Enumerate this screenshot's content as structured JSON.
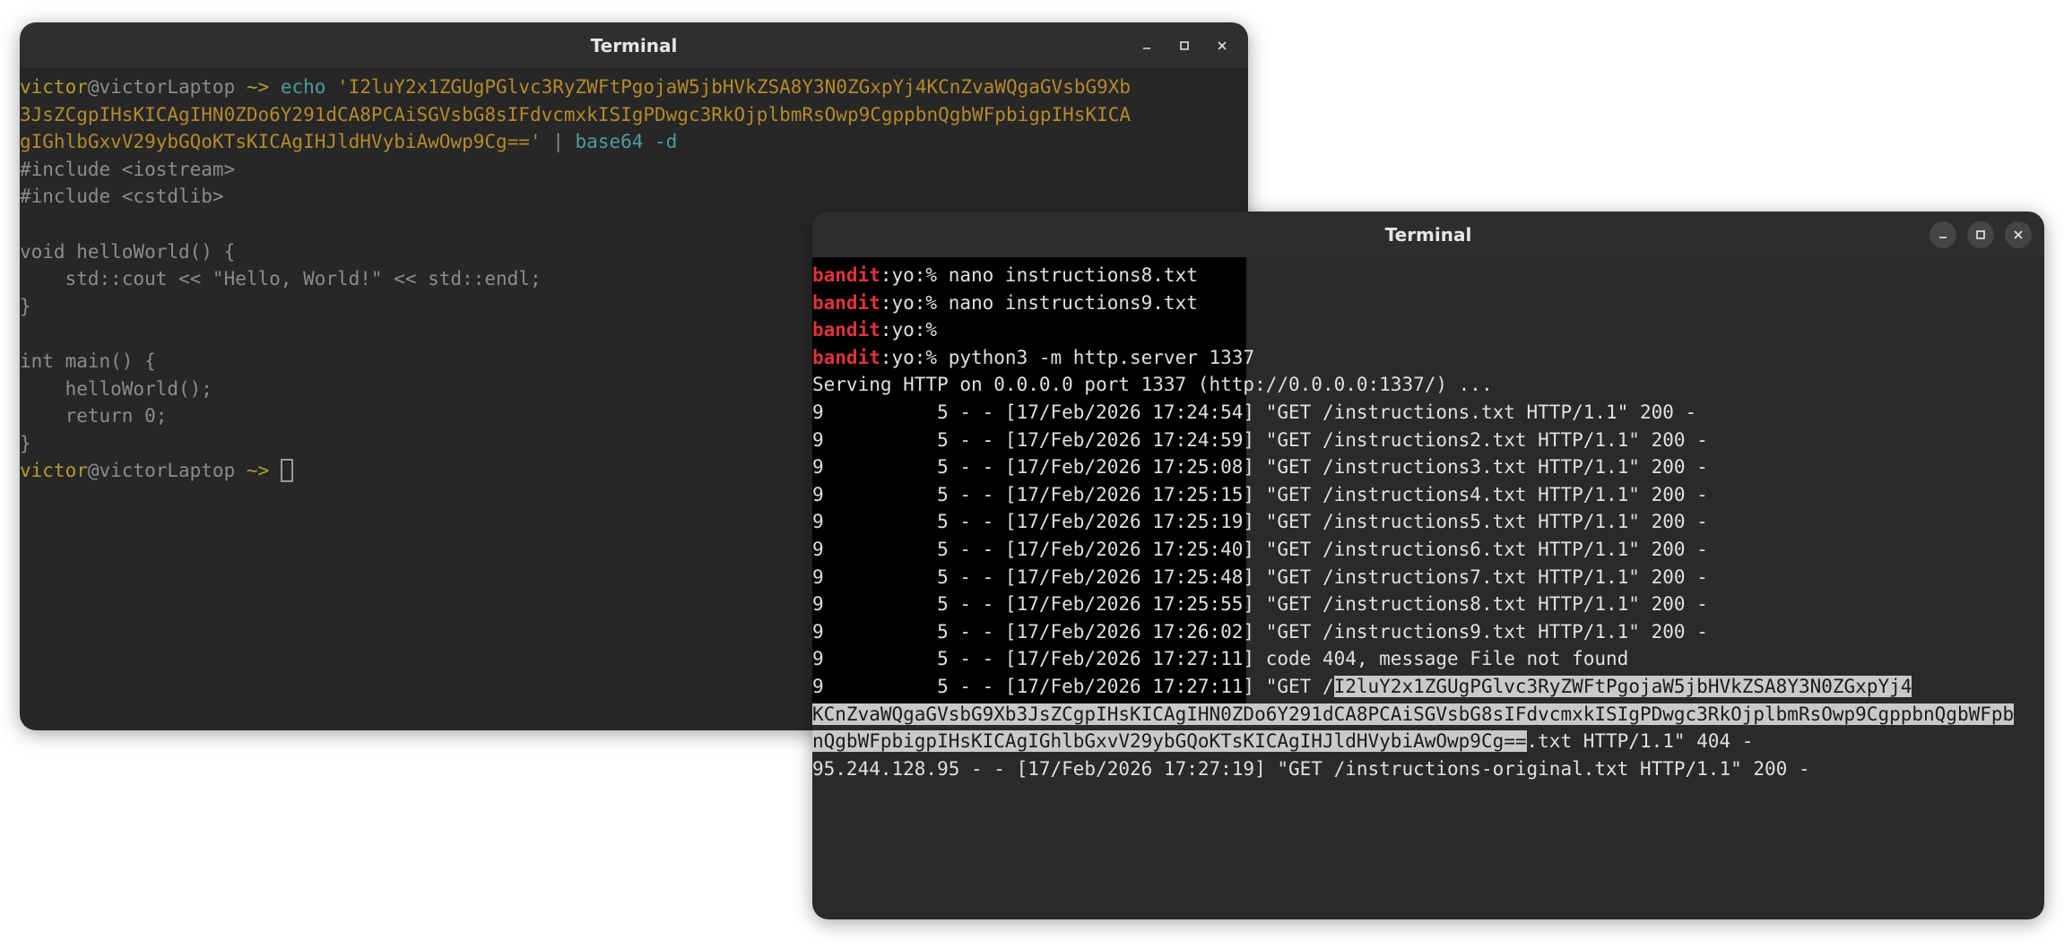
{
  "windows": [
    {
      "title": "Terminal",
      "lines": [
        {
          "segments": [
            {
              "text": "victor",
              "cls": "c-user"
            },
            {
              "text": "@victorLaptop ",
              "cls": "c-host"
            },
            {
              "text": "~> ",
              "cls": "c-arrow"
            },
            {
              "text": "echo ",
              "cls": "c-cmd"
            },
            {
              "text": "'I2luY2x1ZGUgPGlvc3RyZWFtPgojaW5jbHVkZSA8Y3N0ZGxpYj4KCnZvaWQgaGVsbG9Xb",
              "cls": "c-str"
            }
          ]
        },
        {
          "segments": [
            {
              "text": "3JsZCgpIHsKICAgIHN0ZDo6Y291dCA8PCAiSGVsbG8sIFdvcmxkISIgPDwgc3RkOjplbmRsOwp9CgppbnQgbWFpbigpIHsKICA",
              "cls": "c-str"
            }
          ]
        },
        {
          "segments": [
            {
              "text": "gIGhlbGxvV29ybGQoKTsKICAgIHJldHVybiAwOwp9Cg=='",
              "cls": "c-str"
            },
            {
              "text": " | ",
              "cls": "c-pipe"
            },
            {
              "text": "base64 -d",
              "cls": "c-cmd"
            }
          ]
        },
        {
          "segments": [
            {
              "text": "#include <iostream>",
              "cls": ""
            }
          ]
        },
        {
          "segments": [
            {
              "text": "#include <cstdlib>",
              "cls": ""
            }
          ]
        },
        {
          "segments": [
            {
              "text": "",
              "cls": ""
            }
          ]
        },
        {
          "segments": [
            {
              "text": "void helloWorld() {",
              "cls": ""
            }
          ]
        },
        {
          "segments": [
            {
              "text": "    std::cout << \"Hello, World!\" << std::endl;",
              "cls": ""
            }
          ]
        },
        {
          "segments": [
            {
              "text": "}",
              "cls": ""
            }
          ]
        },
        {
          "segments": [
            {
              "text": "",
              "cls": ""
            }
          ]
        },
        {
          "segments": [
            {
              "text": "int main() {",
              "cls": ""
            }
          ]
        },
        {
          "segments": [
            {
              "text": "    helloWorld();",
              "cls": ""
            }
          ]
        },
        {
          "segments": [
            {
              "text": "    return 0;",
              "cls": ""
            }
          ]
        },
        {
          "segments": [
            {
              "text": "}",
              "cls": ""
            }
          ]
        },
        {
          "segments": [
            {
              "text": "victor",
              "cls": "c-user"
            },
            {
              "text": "@victorLaptop ",
              "cls": "c-host"
            },
            {
              "text": "~> ",
              "cls": "c-arrow"
            }
          ],
          "cursor": true
        }
      ]
    },
    {
      "title": "Terminal",
      "lines": [
        {
          "segments": [
            {
              "text": "bandit",
              "cls": "c-bandit"
            },
            {
              "text": ":yo:% ",
              "cls": "c-yo"
            },
            {
              "text": "nano instructions8.txt",
              "cls": ""
            }
          ]
        },
        {
          "segments": [
            {
              "text": "bandit",
              "cls": "c-bandit"
            },
            {
              "text": ":yo:% ",
              "cls": "c-yo"
            },
            {
              "text": "nano instructions9.txt",
              "cls": ""
            }
          ]
        },
        {
          "segments": [
            {
              "text": "bandit",
              "cls": "c-bandit"
            },
            {
              "text": ":yo:% ",
              "cls": "c-yo"
            }
          ]
        },
        {
          "segments": [
            {
              "text": "bandit",
              "cls": "c-bandit"
            },
            {
              "text": ":yo:% ",
              "cls": "c-yo"
            },
            {
              "text": "python3 -m http.server 1337",
              "cls": ""
            }
          ]
        },
        {
          "segments": [
            {
              "text": "Serving HTTP on 0.0.0.0 port 1337 (http://0.0.0.0:1337/) ...",
              "cls": ""
            }
          ]
        },
        {
          "segments": [
            {
              "text": "9          5 - - [17/Feb/2026 17:24:54] \"GET /instructions.txt HTTP/1.1\" 200 -",
              "cls": ""
            }
          ]
        },
        {
          "segments": [
            {
              "text": "9          5 - - [17/Feb/2026 17:24:59] \"GET /instructions2.txt HTTP/1.1\" 200 -",
              "cls": ""
            }
          ]
        },
        {
          "segments": [
            {
              "text": "9          5 - - [17/Feb/2026 17:25:08] \"GET /instructions3.txt HTTP/1.1\" 200 -",
              "cls": ""
            }
          ]
        },
        {
          "segments": [
            {
              "text": "9          5 - - [17/Feb/2026 17:25:15] \"GET /instructions4.txt HTTP/1.1\" 200 -",
              "cls": ""
            }
          ]
        },
        {
          "segments": [
            {
              "text": "9          5 - - [17/Feb/2026 17:25:19] \"GET /instructions5.txt HTTP/1.1\" 200 -",
              "cls": ""
            }
          ]
        },
        {
          "segments": [
            {
              "text": "9          5 - - [17/Feb/2026 17:25:40] \"GET /instructions6.txt HTTP/1.1\" 200 -",
              "cls": ""
            }
          ]
        },
        {
          "segments": [
            {
              "text": "9          5 - - [17/Feb/2026 17:25:48] \"GET /instructions7.txt HTTP/1.1\" 200 -",
              "cls": ""
            }
          ]
        },
        {
          "segments": [
            {
              "text": "9          5 - - [17/Feb/2026 17:25:55] \"GET /instructions8.txt HTTP/1.1\" 200 -",
              "cls": ""
            }
          ]
        },
        {
          "segments": [
            {
              "text": "9          5 - - [17/Feb/2026 17:26:02] \"GET /instructions9.txt HTTP/1.1\" 200 -",
              "cls": ""
            }
          ]
        },
        {
          "segments": [
            {
              "text": "9          5 - - [17/Feb/2026 17:27:11] code 404, message File not found",
              "cls": ""
            }
          ]
        },
        {
          "segments": [
            {
              "text": "9          5 - - [17/Feb/2026 17:27:11] \"GET /",
              "cls": ""
            },
            {
              "text": "I2luY2x1ZGUgPGlvc3RyZWFtPgojaW5jbHVkZSA8Y3N0ZGxpYj4",
              "cls": "hl"
            }
          ]
        },
        {
          "segments": [
            {
              "text": "KCnZvaWQgaGVsbG9Xb3JsZCgpIHsKICAgIHN0ZDo6Y291dCA8PCAiSGVsbG8sIFdvcmxkISIgPDwgc3RkOjplbmRsOwp9CgppbnQgbWFpb",
              "cls": "hl"
            }
          ]
        },
        {
          "segments": [
            {
              "text": "nQgbWFpbigpIHsKICAgIGhlbGxvV29ybGQoKTsKICAgIHJldHVybiAwOwp9Cg==",
              "cls": "hl"
            },
            {
              "text": ".txt HTTP/1.1\" 404 -",
              "cls": ""
            }
          ]
        },
        {
          "segments": [
            {
              "text": "95.244.128.95 - - [17/Feb/2026 17:27:19] \"GET /instructions-original.txt HTTP/1.1\" 200 -",
              "cls": ""
            }
          ]
        }
      ]
    }
  ]
}
